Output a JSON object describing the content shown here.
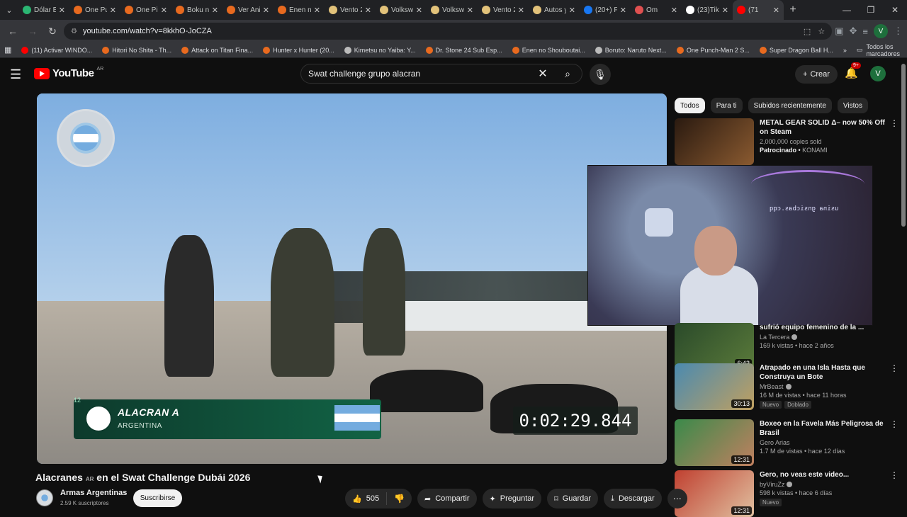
{
  "browser": {
    "tabs": [
      {
        "label": "Dólar B",
        "color": "#2bb673"
      },
      {
        "label": "One Pu",
        "color": "#e86a1f"
      },
      {
        "label": "One Pi",
        "color": "#e86a1f"
      },
      {
        "label": "Boku n",
        "color": "#e86a1f"
      },
      {
        "label": "Ver Ani",
        "color": "#e86a1f"
      },
      {
        "label": "Enen n",
        "color": "#e86a1f"
      },
      {
        "label": "Vento 2",
        "color": "#e2c27a"
      },
      {
        "label": "Volksw",
        "color": "#e2c27a"
      },
      {
        "label": "Volksw",
        "color": "#e2c27a"
      },
      {
        "label": "Vento 2",
        "color": "#e2c27a"
      },
      {
        "label": "Autos y",
        "color": "#e2c27a"
      },
      {
        "label": "(20+) F",
        "color": "#1877f2"
      },
      {
        "label": "Om",
        "color": "#e05050"
      },
      {
        "label": "(23)Tik",
        "color": "#ffffff"
      },
      {
        "label": "(71",
        "color": "#ff0000"
      }
    ],
    "url": "youtube.com/watch?v=8kkhO-JoCZA",
    "bookmarks": [
      {
        "label": "(11) Activar WINDO...",
        "color": "#ff0000"
      },
      {
        "label": "Hitori No Shita - Th...",
        "color": "#e86a1f"
      },
      {
        "label": "Attack on Titan Fina...",
        "color": "#e86a1f"
      },
      {
        "label": "Hunter x Hunter (20...",
        "color": "#e86a1f"
      },
      {
        "label": "Kimetsu no Yaiba: Y...",
        "color": "#bbbbbb"
      },
      {
        "label": "Dr. Stone 24 Sub Esp...",
        "color": "#e86a1f"
      },
      {
        "label": "Enen no Shouboutai...",
        "color": "#e86a1f"
      },
      {
        "label": "Boruto: Naruto Next...",
        "color": "#bbbbbb"
      },
      {
        "label": "One Punch-Man 2 S...",
        "color": "#e86a1f"
      },
      {
        "label": "Super Dragon Ball H...",
        "color": "#e86a1f"
      }
    ],
    "all_bookmarks": "Todos los marcadores",
    "profile_initial": "V"
  },
  "youtube": {
    "logo_text": "YouTube",
    "region": "AR",
    "search_query": "Swat challenge grupo alacran",
    "create_label": "Crear",
    "notif_count": "9+",
    "avatar_initial": "V"
  },
  "video": {
    "overlay_number": "12",
    "team": "ALACRAN A",
    "country": "ARGENTINA",
    "timer": "0:02:29.844",
    "webcam_text": "usina gnsicbas.cqq",
    "title_main": "Alacranes",
    "title_ar": "AR",
    "title_rest": "en el Swat Challenge Dubái 2026",
    "channel": "Armas Argentinas",
    "subscribers": "2.59 K suscriptores",
    "subscribe_label": "Suscribirse",
    "likes": "505",
    "share_label": "Compartir",
    "ask_label": "Preguntar",
    "save_label": "Guardar",
    "download_label": "Descargar"
  },
  "sidebar": {
    "chips": [
      "Todos",
      "Para ti",
      "Subidos recientemente",
      "Vistos"
    ],
    "items": [
      {
        "title": "METAL GEAR SOLID Δ– now 50% Off on Steam",
        "line2": "2,000,000 copies sold",
        "sponsored": "Patrocinado",
        "sponsor": "KONAMI",
        "duration": "",
        "thumb": "#5a3a20"
      },
      {
        "title": "sufrió equipo femenino de la ...",
        "channel": "La Tercera",
        "meta": "169 k vistas • hace 2 años",
        "duration": "6:43",
        "thumb": "#3d5a2a"
      },
      {
        "title": "Atrapado en una Isla Hasta que Construya un Bote",
        "channel": "MrBeast",
        "meta": "16 M de vistas • hace 11 horas",
        "tag1": "Nuevo",
        "tag2": "Doblado",
        "duration": "30:13",
        "thumb": "#5aa0c0"
      },
      {
        "title": "Boxeo en la Favela Más Peligrosa de Brasil",
        "channel": "Gero Arias",
        "meta": "1.7 M de vistas • hace 12 días",
        "duration": "12:31",
        "thumb": "#3f8a50"
      },
      {
        "title": "Gero, no veas este video...",
        "channel": "byViruZz",
        "meta": "598 k vistas • hace 6 días",
        "tag1": "Nuevo",
        "duration": "12:31",
        "thumb": "#b04030"
      }
    ]
  }
}
